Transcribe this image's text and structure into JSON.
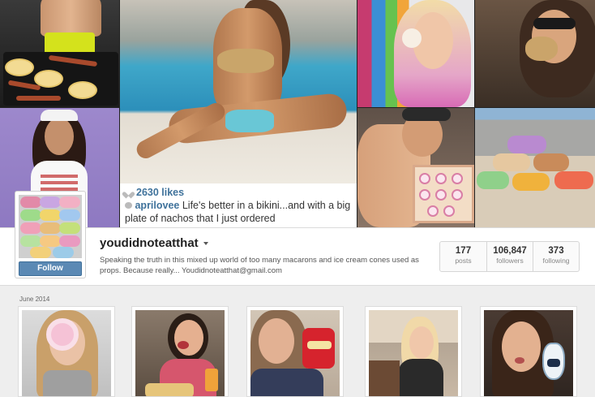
{
  "post": {
    "likes": "2630 likes",
    "caption_user": "aprilovee",
    "caption_text": "Life's better in a bikini...and with a big plate of nachos that I just ordered"
  },
  "profile": {
    "username": "youdidnoteatthat",
    "bio": "Speaking the truth in this mixed up world of too many macarons and ice cream cones used as props. Because really... Youdidnoteatthat@gmail.com",
    "follow_label": "Follow",
    "stats": [
      {
        "value": "177",
        "label": "posts"
      },
      {
        "value": "106,847",
        "label": "followers"
      },
      {
        "value": "373",
        "label": "following"
      }
    ]
  },
  "grid": {
    "section_label": "June 2014"
  },
  "colors": {
    "link_blue": "#3f729b",
    "follow_button": "#5b89b4",
    "page_bg": "#eeeeee"
  },
  "icons": {
    "like": "heart-icon",
    "comment": "comment-bubble-icon",
    "menu": "caret-down-icon"
  }
}
